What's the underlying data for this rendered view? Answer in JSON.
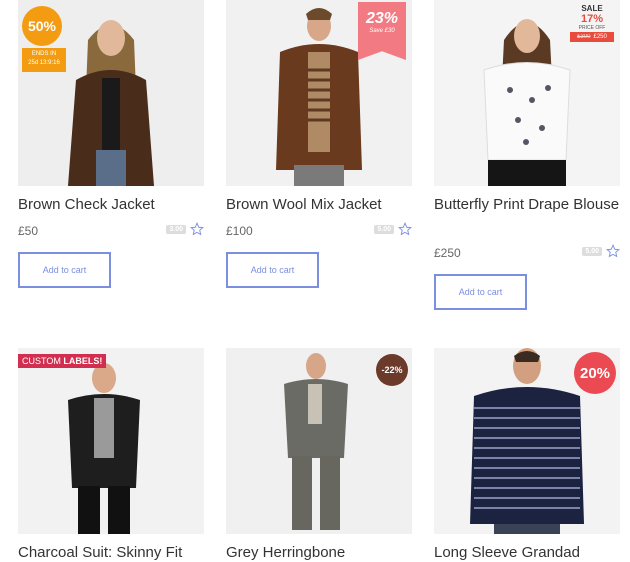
{
  "products": [
    {
      "title": "Brown Check Jacket",
      "price": "£50",
      "rating": "3.00",
      "cart": "Add to cart",
      "label": {
        "pct": "50%",
        "ends1": "ENDS IN",
        "ends2": "25d 13:9:16"
      }
    },
    {
      "title": "Brown Wool Mix Jacket",
      "price": "£100",
      "rating": "5.00",
      "cart": "Add to cart",
      "label": {
        "pct": "23%",
        "save": "Save £30"
      }
    },
    {
      "title": "Butterfly Print Drape Blouse",
      "price": "£250",
      "rating": "5.00",
      "cart": "Add to cart",
      "label": {
        "sale": "SALE",
        "pct": "17%",
        "priceoff": "PRICE OFF",
        "old": "£300",
        "new": "£250"
      }
    },
    {
      "title": "Charcoal Suit: Skinny Fit",
      "label": {
        "text1": "CUSTOM ",
        "text2": "LABELS!"
      }
    },
    {
      "title": "Grey Herringbone",
      "label": {
        "pct": "-22%"
      }
    },
    {
      "title": "Long Sleeve Grandad",
      "label": {
        "pct": "20%"
      }
    }
  ]
}
